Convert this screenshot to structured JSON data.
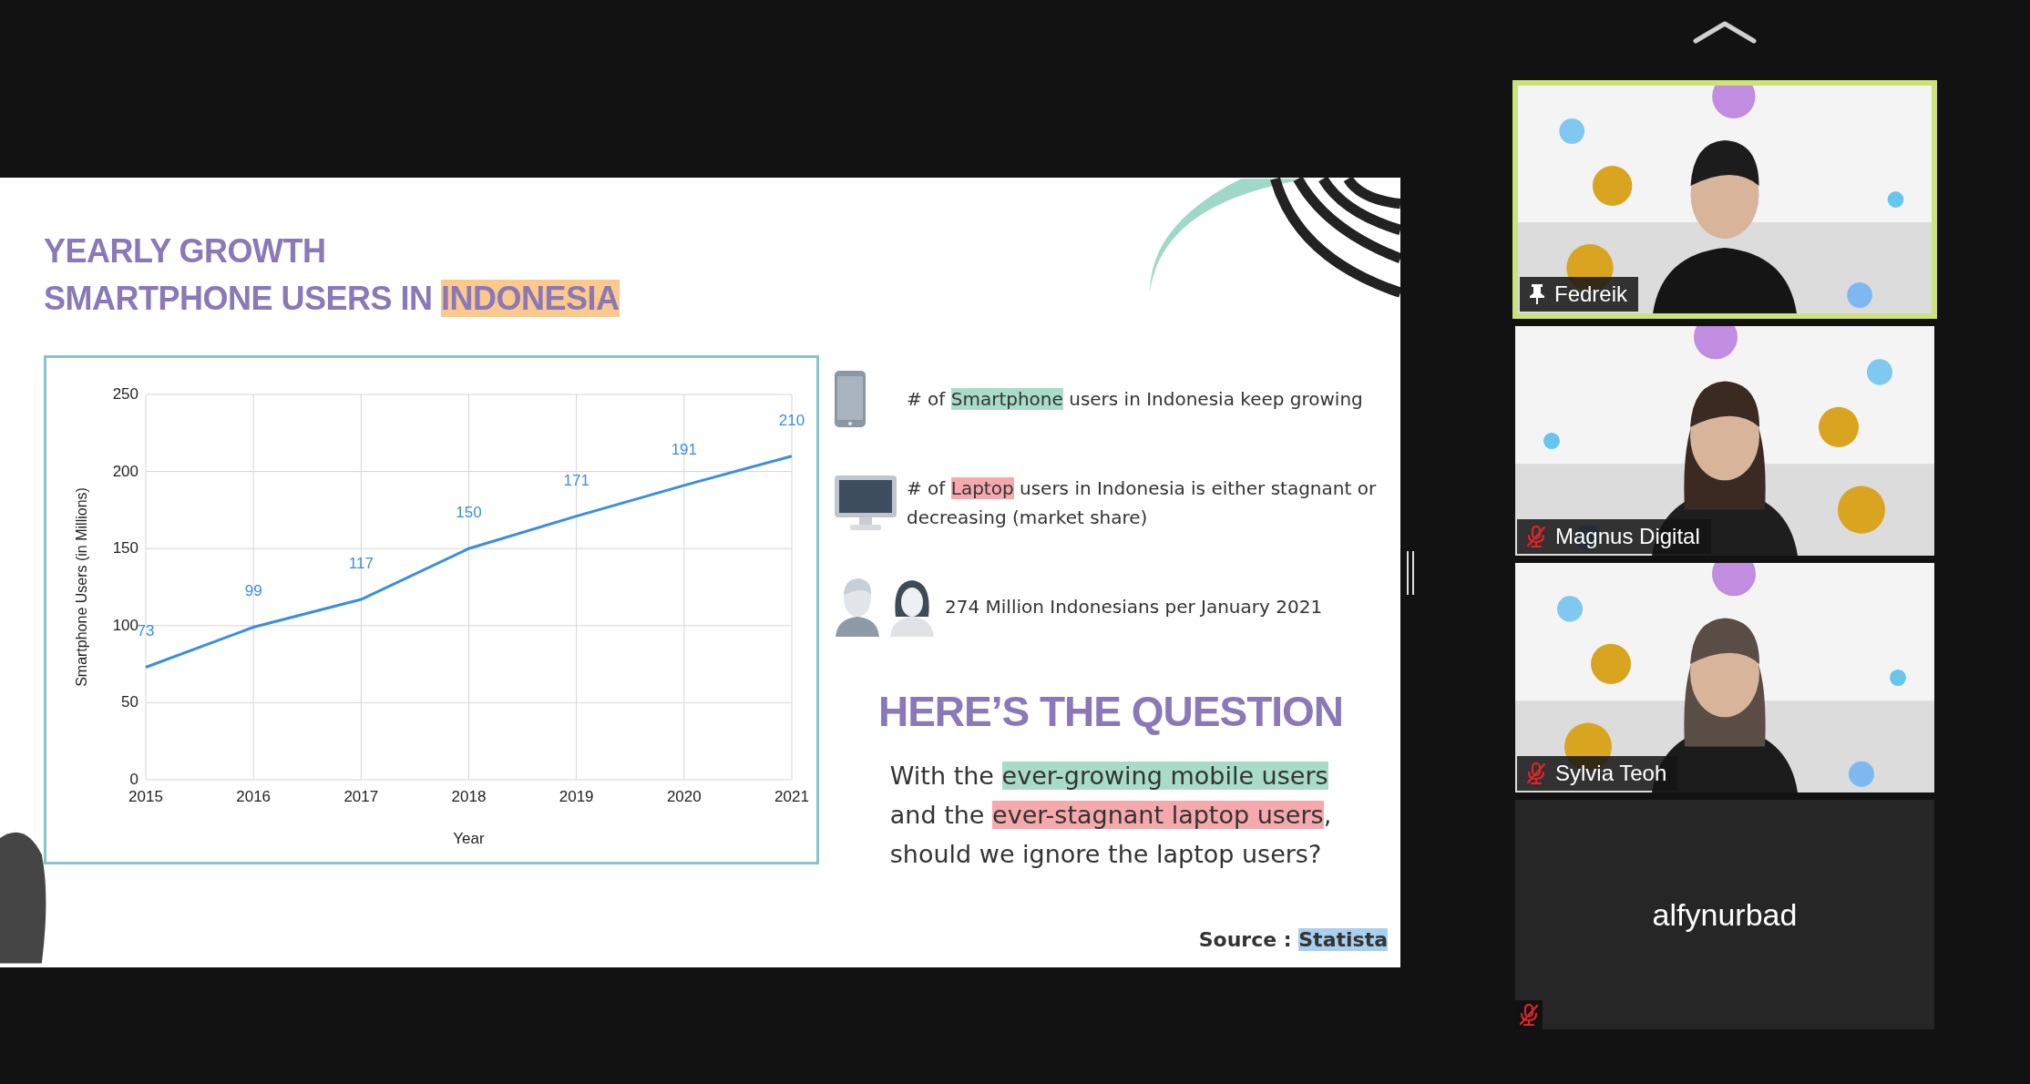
{
  "slide": {
    "title_lines": [
      [
        {
          "text": "YEARLY GROWTH"
        }
      ],
      [
        {
          "text": "SMARTPHONE USERS IN "
        },
        {
          "text": "INDONESIA",
          "color": "#fcc98c"
        }
      ]
    ],
    "chart_data": {
      "type": "line",
      "xlabel": "Year",
      "ylabel": "Smartphone Users (in Millions)",
      "categories": [
        "2015",
        "2016",
        "2017",
        "2018",
        "2019",
        "2020",
        "2021"
      ],
      "grid": true,
      "series": [
        {
          "color": "#3a8ee0",
          "values": [
            73,
            99,
            117,
            150,
            171,
            191,
            210
          ]
        }
      ],
      "ylim": [
        0,
        250
      ],
      "yticks": [
        0,
        50,
        100,
        150,
        200,
        250
      ],
      "data_labels": true
    },
    "facts": [
      {
        "kind": "phone",
        "segments": [
          {
            "text": "# of "
          },
          {
            "text": "Smartphone",
            "color": "#a8dcc8"
          },
          {
            "text": " users in Indonesia keep growing"
          }
        ]
      },
      {
        "kind": "monitor",
        "segments": [
          {
            "text": "# of "
          },
          {
            "text": "Laptop",
            "color": "#f6a9ad"
          },
          {
            "text": " users in Indonesia is either stagnant or decreasing (market share)"
          }
        ]
      },
      {
        "kind": "people",
        "segments": [
          {
            "text": "274 Million Indonesians per January 2021"
          }
        ]
      }
    ],
    "question": {
      "heading": "HERE’S THE QUESTION",
      "lines": [
        [
          {
            "text": "With the "
          },
          {
            "text": "ever-growing mobile users",
            "color": "#a8dcc8"
          }
        ],
        [
          {
            "text": "and the "
          },
          {
            "text": "ever-stagnant laptop users",
            "color": "#f6a9ad"
          },
          {
            "text": ","
          }
        ],
        [
          {
            "text": "should we ignore the laptop users?"
          }
        ]
      ]
    },
    "source": [
      {
        "text": "Source : "
      },
      {
        "text": "Statista",
        "color": "#a9cfee"
      }
    ]
  },
  "participants": [
    {
      "name": "Fedreik",
      "kind": "video",
      "active": true,
      "pinned": true,
      "muted": false
    },
    {
      "name": "Magnus Digital",
      "kind": "video",
      "active": false,
      "pinned": false,
      "muted": true
    },
    {
      "name": "Sylvia Teoh",
      "kind": "video",
      "active": false,
      "pinned": false,
      "muted": true
    },
    {
      "name": "alfynurbad",
      "kind": "avatar",
      "active": false,
      "pinned": false,
      "muted": true
    }
  ]
}
